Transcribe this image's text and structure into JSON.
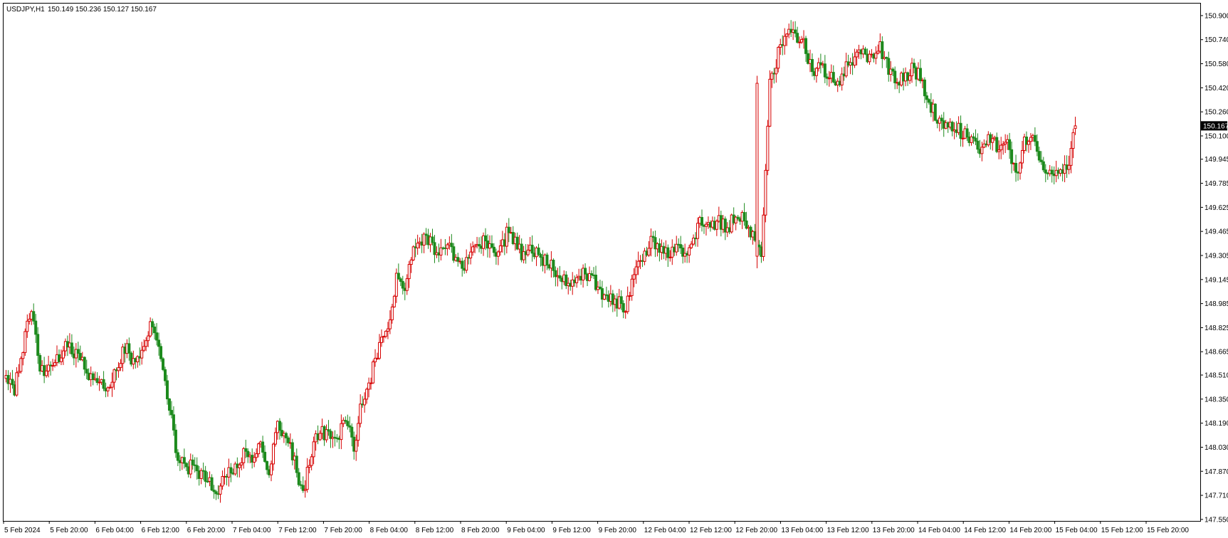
{
  "header": {
    "symbol_timeframe": "USDJPY,H1",
    "ohlc_text": "150.149 150.236 150.127 150.167"
  },
  "current_price_label": "150.167",
  "colors": {
    "background": "#ffffff",
    "frame": "#000000",
    "bull": "#d60000",
    "bear": "#1d8a1d",
    "price_tag_bg": "#000000"
  },
  "chart_data": {
    "type": "candlestick",
    "symbol": "USDJPY",
    "timeframe": "H1",
    "ylim": [
      147.54,
      150.98
    ],
    "y_ticks": [
      "150.900",
      "150.740",
      "150.580",
      "150.420",
      "150.260",
      "150.100",
      "149.945",
      "149.785",
      "149.625",
      "149.465",
      "149.305",
      "149.145",
      "148.985",
      "148.825",
      "148.665",
      "148.510",
      "148.350",
      "148.190",
      "148.030",
      "147.870",
      "147.710",
      "147.550"
    ],
    "x_ticks": [
      "5 Feb 2024",
      "5 Feb 20:00",
      "6 Feb 04:00",
      "6 Feb 12:00",
      "6 Feb 20:00",
      "7 Feb 04:00",
      "7 Feb 12:00",
      "7 Feb 20:00",
      "8 Feb 04:00",
      "8 Feb 12:00",
      "8 Feb 20:00",
      "9 Feb 04:00",
      "9 Feb 12:00",
      "9 Feb 20:00",
      "12 Feb 04:00",
      "12 Feb 12:00",
      "12 Feb 20:00",
      "13 Feb 04:00",
      "13 Feb 12:00",
      "13 Feb 20:00",
      "14 Feb 04:00",
      "14 Feb 12:00",
      "14 Feb 20:00",
      "15 Feb 04:00",
      "15 Feb 12:00",
      "15 Feb 20:00"
    ],
    "grid": false,
    "anchors": [
      [
        148.52,
        148.42
      ],
      [
        148.7,
        148.95
      ],
      [
        148.55,
        148.55
      ],
      [
        148.6,
        148.7
      ],
      [
        148.65,
        148.6
      ],
      [
        148.5,
        148.45
      ],
      [
        148.4,
        148.55
      ],
      [
        148.7,
        148.6
      ],
      [
        148.65,
        148.85
      ],
      [
        148.7,
        148.4
      ],
      [
        148.0,
        147.9
      ],
      [
        147.9,
        147.85
      ],
      [
        147.8,
        147.75
      ],
      [
        147.85,
        147.9
      ],
      [
        148.0,
        147.95
      ],
      [
        148.1,
        147.85
      ],
      [
        148.2,
        148.1
      ],
      [
        147.95,
        147.7
      ],
      [
        148.0,
        148.15
      ],
      [
        148.1,
        148.1
      ],
      [
        148.2,
        148.05
      ],
      [
        148.35,
        148.5
      ],
      [
        148.7,
        148.85
      ],
      [
        149.15,
        149.1
      ],
      [
        149.35,
        149.4
      ],
      [
        149.4,
        149.3
      ],
      [
        149.35,
        149.3
      ],
      [
        149.25,
        149.35
      ],
      [
        149.4,
        149.35
      ],
      [
        149.3,
        149.45
      ],
      [
        149.4,
        149.3
      ],
      [
        149.35,
        149.3
      ],
      [
        149.25,
        149.2
      ],
      [
        149.15,
        149.1
      ],
      [
        149.2,
        149.15
      ],
      [
        149.05,
        149.0
      ],
      [
        149.0,
        148.95
      ],
      [
        149.2,
        149.25
      ],
      [
        149.4,
        149.35
      ],
      [
        149.3,
        149.35
      ],
      [
        149.3,
        149.4
      ],
      [
        149.55,
        149.5
      ],
      [
        149.55,
        149.45
      ],
      [
        149.6,
        149.55
      ],
      [
        149.45,
        149.3
      ],
      [
        150.45,
        150.65
      ],
      [
        150.8,
        150.75
      ],
      [
        150.7,
        150.55
      ],
      [
        150.55,
        150.5
      ],
      [
        150.45,
        150.55
      ],
      [
        150.6,
        150.65
      ],
      [
        150.6,
        150.7
      ],
      [
        150.55,
        150.45
      ],
      [
        150.5,
        150.55
      ],
      [
        150.45,
        150.3
      ],
      [
        150.2,
        150.2
      ],
      [
        150.15,
        150.1
      ],
      [
        150.05,
        150.0
      ],
      [
        150.1,
        150.0
      ],
      [
        150.05,
        149.85
      ],
      [
        150.05,
        150.15
      ],
      [
        149.9,
        149.85
      ],
      [
        149.9,
        149.85
      ],
      [
        150.167
      ]
    ],
    "last_candle": {
      "open": 150.149,
      "high": 150.236,
      "low": 150.127,
      "close": 150.167
    },
    "source_note_hidden": ""
  }
}
